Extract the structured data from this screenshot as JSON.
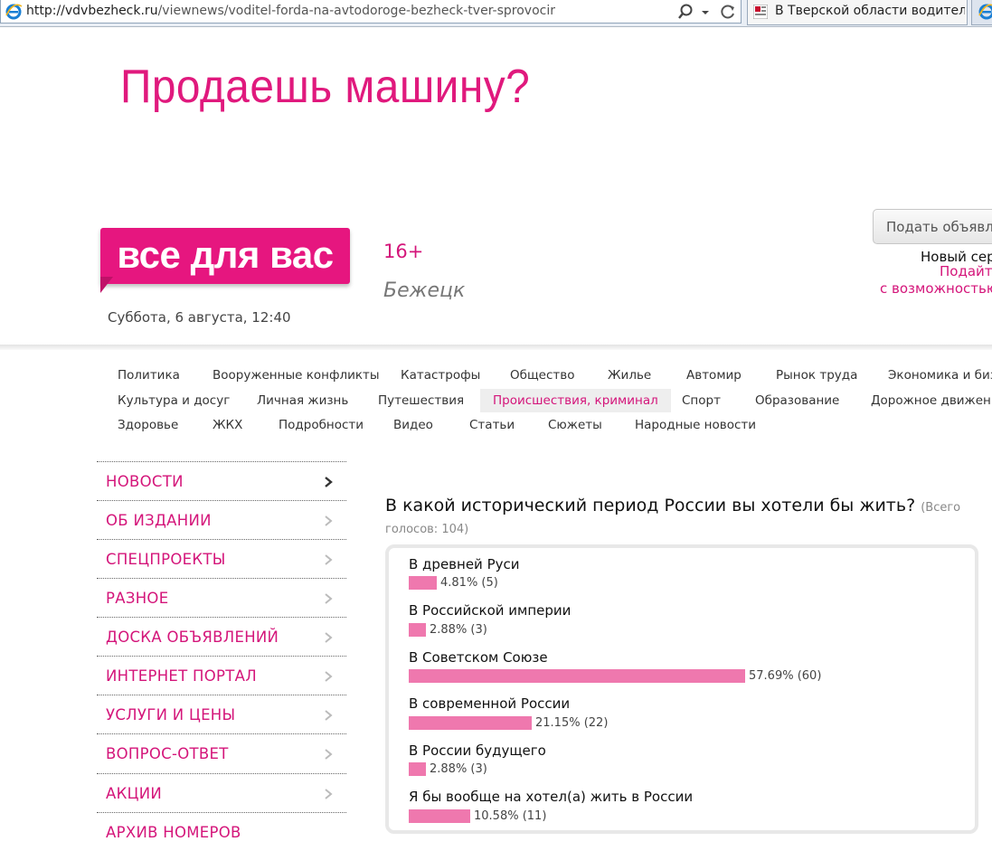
{
  "browser": {
    "url_domain": "http://vdvbezheck.ru",
    "url_path": "/viewnews/voditel-forda-na-avtodoroge-bezheck-tver-sprovocir",
    "tab_title": "В Тверской области водител..."
  },
  "banner": {
    "text": "Продаешь машину?"
  },
  "header": {
    "logo": "все для вас",
    "age_rating": "16+",
    "city": "Бежецк",
    "datetime": "Суббота, 6 августа, 12:40",
    "post_button": "Подать объявле",
    "new_service": "Новый сер",
    "submit_link": "Подайте",
    "possibilities_link": "с возможностью"
  },
  "categories": {
    "row1": [
      "Политика",
      "Вооруженные конфликты",
      "Катастрофы",
      "Общество",
      "Жилье",
      "Автомир",
      "Рынок труда",
      "Экономика и бизн"
    ],
    "row2": [
      "Культура и досуг",
      "Личная жизнь",
      "Путешествия",
      "Происшествия, криминал",
      "Спорт",
      "Образование",
      "Дорожное движение"
    ],
    "row3": [
      "Здоровье",
      "ЖКХ",
      "Подробности",
      "Видео",
      "Статьи",
      "Сюжеты",
      "Народные новости"
    ],
    "active": "Происшествия, криминал"
  },
  "sidebar": {
    "items": [
      "НОВОСТИ",
      "ОБ ИЗДАНИИ",
      "СПЕЦПРОЕКТЫ",
      "РАЗНОЕ",
      "ДОСКА ОБЪЯВЛЕНИЙ",
      "ИНТЕРНЕТ ПОРТАЛ",
      "УСЛУГИ И ЦЕНЫ",
      "ВОПРОС-ОТВЕТ",
      "АКЦИИ",
      "АРХИВ НОМЕРОВ"
    ]
  },
  "poll": {
    "question": "В какой исторический период России вы хотели бы жить?",
    "total_part1": "(Всего",
    "total_part2": "голосов: 104)",
    "options": [
      {
        "label": "В древней Руси",
        "percent": 4.81,
        "result": "4.81% (5)"
      },
      {
        "label": "В Российской империи",
        "percent": 2.88,
        "result": "2.88% (3)"
      },
      {
        "label": "В Советском Союзе",
        "percent": 57.69,
        "result": "57.69% (60)"
      },
      {
        "label": "В современной России",
        "percent": 21.15,
        "result": "21.15% (22)"
      },
      {
        "label": "В России будущего",
        "percent": 2.88,
        "result": "2.88% (3)"
      },
      {
        "label": "Я бы вообще на хотел(а) жить в России",
        "percent": 10.58,
        "result": "10.58% (11)"
      }
    ]
  },
  "colors": {
    "accent": "#e6167f",
    "bar": "#ef78ae",
    "link": "#d4157a"
  }
}
